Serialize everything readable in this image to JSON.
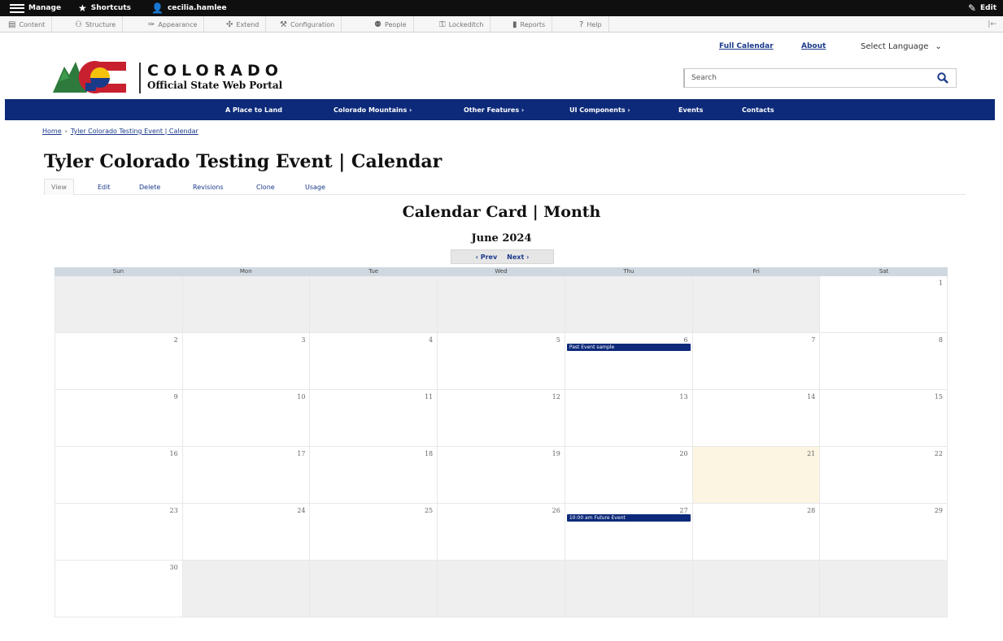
{
  "admin_bar": {
    "manage": "Manage",
    "shortcuts": "Shortcuts",
    "user": "cecilia.hamlee",
    "edit": "Edit"
  },
  "admin_tray": {
    "items": [
      "Content",
      "Structure",
      "Appearance",
      "Extend",
      "Configuration",
      "People",
      "Lockeditch",
      "Reports",
      "Help"
    ],
    "collapse": "|←"
  },
  "utility": {
    "full_calendar": "Full Calendar",
    "about": "About",
    "language": "Select Language",
    "language_chevron": "⌄"
  },
  "logo": {
    "word": "COLORADO",
    "sub": "Official State Web Portal"
  },
  "search": {
    "placeholder": "Search"
  },
  "nav": {
    "items": [
      "A Place to Land",
      "Colorado Mountains ›",
      "Other Features ›",
      "UI Components ›",
      "Events",
      "Contacts"
    ]
  },
  "breadcrumb": {
    "home": "Home",
    "separator": "›",
    "current": "Tyler Colorado Testing Event | Calendar"
  },
  "page": {
    "title": "Tyler Colorado Testing Event | Calendar"
  },
  "tabs": [
    "View",
    "Edit",
    "Delete",
    "Revisions",
    "Clone",
    "Usage"
  ],
  "calendar": {
    "heading": "Calendar Card | Month",
    "month": "June 2024",
    "prev": "‹ Prev",
    "next": "Next ›",
    "weekdays": [
      "Sun",
      "Mon",
      "Tue",
      "Wed",
      "Thu",
      "Fri",
      "Sat"
    ],
    "weeks": [
      [
        null,
        null,
        null,
        null,
        null,
        null,
        1
      ],
      [
        2,
        3,
        4,
        5,
        6,
        7,
        8
      ],
      [
        9,
        10,
        11,
        12,
        13,
        14,
        15
      ],
      [
        16,
        17,
        18,
        19,
        20,
        21,
        22
      ],
      [
        23,
        24,
        25,
        26,
        27,
        28,
        29
      ],
      [
        30,
        null,
        null,
        null,
        null,
        null,
        null
      ]
    ],
    "today": 21,
    "events": [
      {
        "day": 6,
        "label": "Past Event sample"
      },
      {
        "day": 27,
        "label": "10:00 am Future Event"
      }
    ]
  },
  "colors": {
    "brand_navy": "#0d2a7a",
    "admin_black": "#0f0f0f",
    "today_bg": "#fbf5e1",
    "empty_bg": "#efefef"
  }
}
